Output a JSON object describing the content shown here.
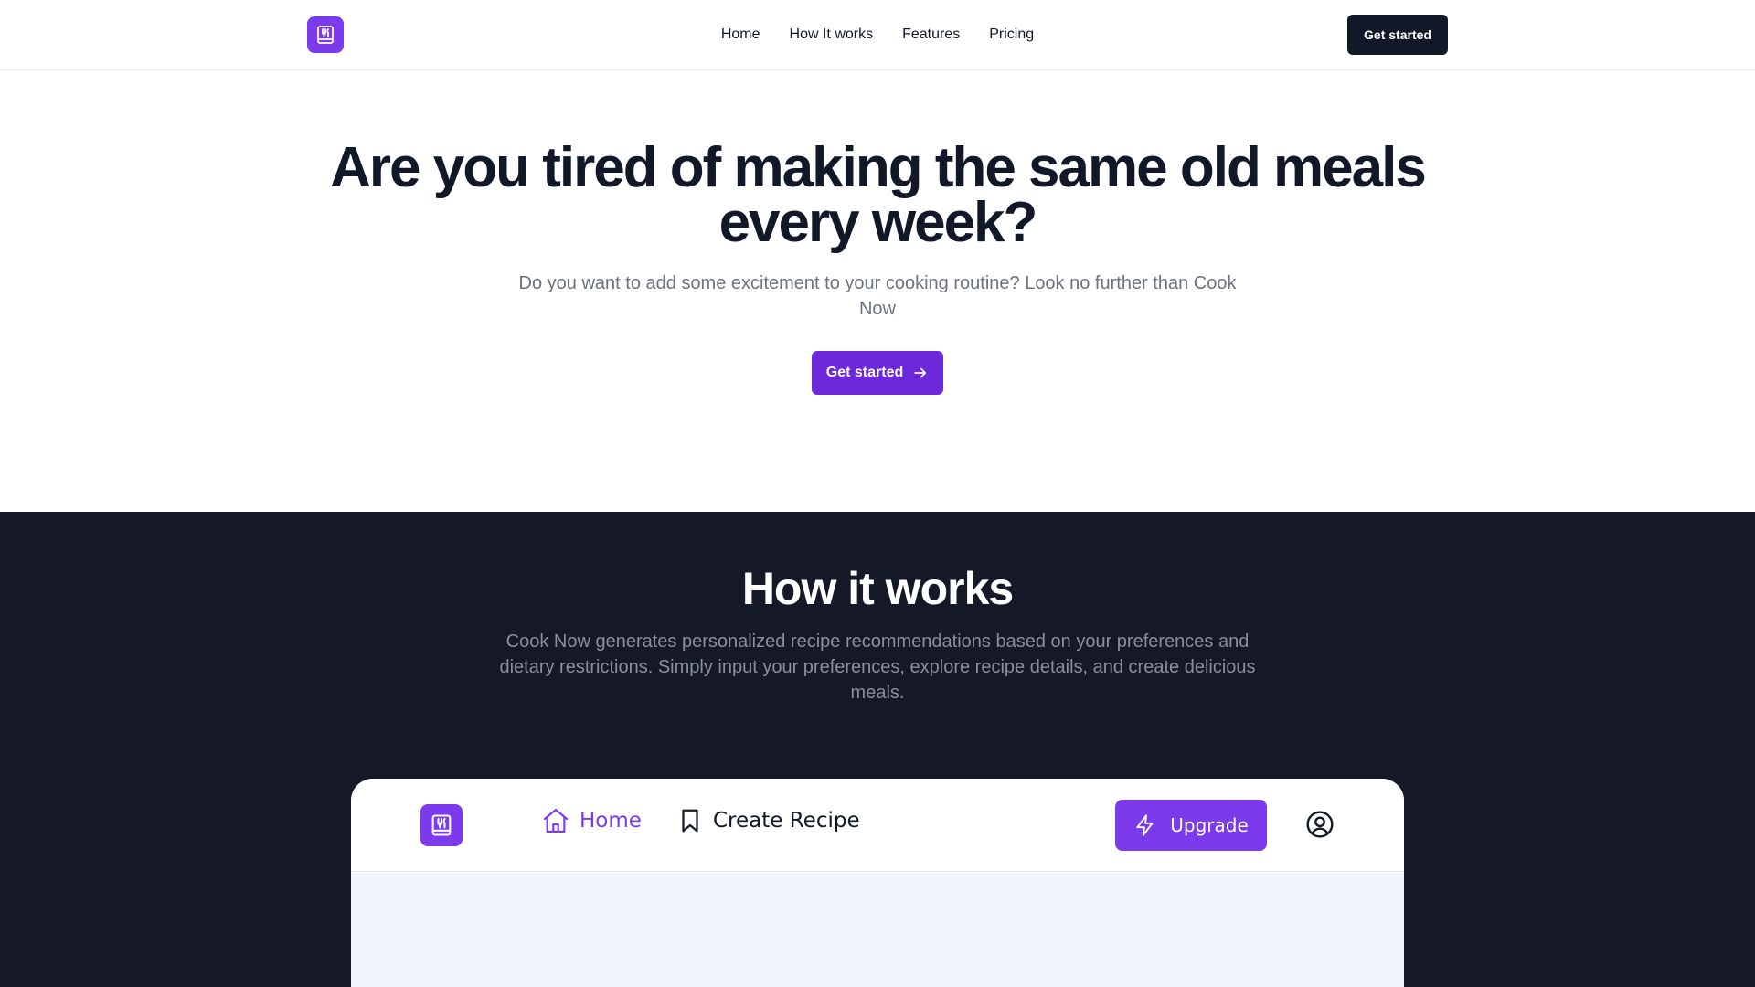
{
  "nav": {
    "links": [
      "Home",
      "How It works",
      "Features",
      "Pricing"
    ],
    "cta_label": "Get started",
    "logo_icon": "cooking-book-icon"
  },
  "hero": {
    "title": "Are you tired of making the same old meals every week?",
    "subtitle": "Do you want to add some excitement to your cooking routine? Look no further than Cook Now",
    "cta_label": "Get started",
    "cta_icon": "arrow-right-icon"
  },
  "how_it_works": {
    "title": "How it works",
    "description": "Cook Now generates personalized recipe recommendations based on your preferences and dietary restrictions. Simply input your preferences, explore recipe details, and create delicious meals."
  },
  "app_preview": {
    "nav": {
      "home_label": "Home",
      "create_label": "Create Recipe",
      "upgrade_label": "Upgrade",
      "icons": [
        "cooking-book-icon",
        "home-icon",
        "bookmark-icon",
        "lightning-icon",
        "user-circle-icon"
      ]
    }
  },
  "colors": {
    "accent": "#7c3aed",
    "dark_section": "#141827",
    "text_primary": "#111827",
    "text_muted": "#6b7280"
  }
}
